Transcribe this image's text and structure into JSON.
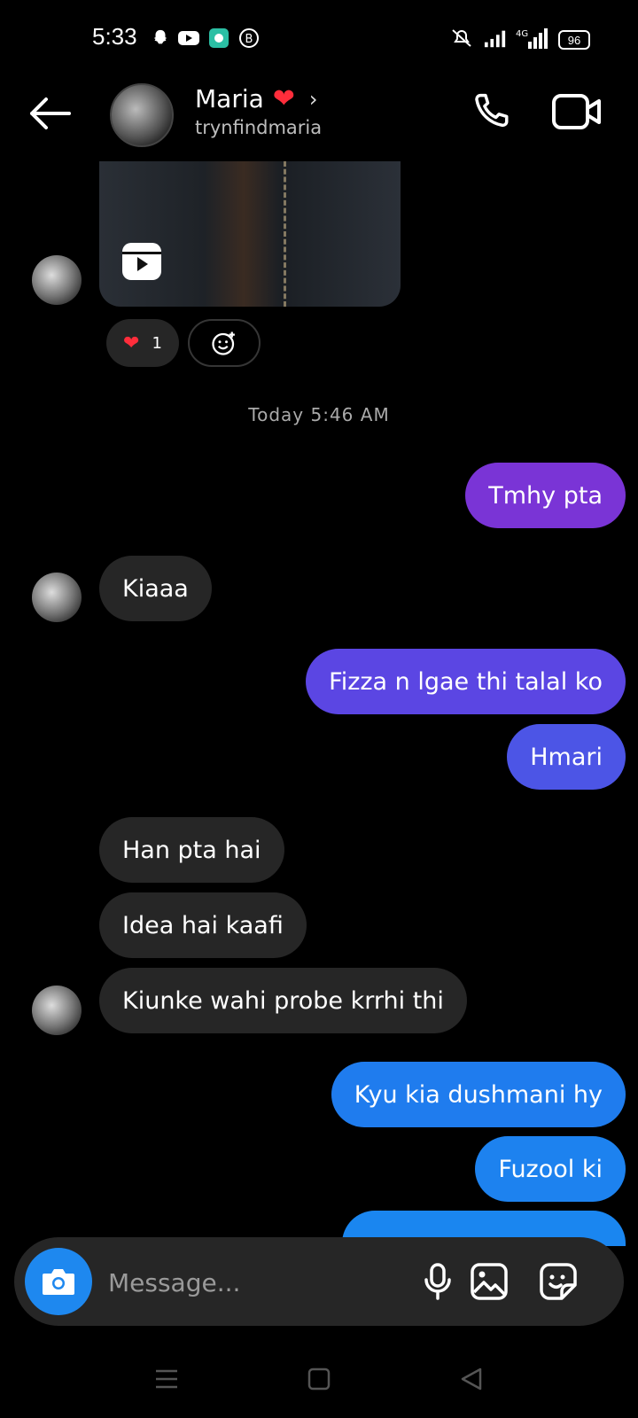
{
  "status_bar": {
    "time": "5:33",
    "battery": "96",
    "network": "4G",
    "icons": [
      "snapchat-icon",
      "youtube-icon",
      "app-icon",
      "b-icon",
      "mute-icon",
      "signal-icon",
      "signal-4g-icon",
      "battery-icon"
    ]
  },
  "header": {
    "name": "Maria",
    "name_emoji": "❤",
    "username": "trynfindmaria",
    "back_icon": "back-arrow-icon",
    "call_icon": "phone-icon",
    "video_icon": "video-call-icon"
  },
  "reactions": {
    "heart_emoji": "❤",
    "heart_count": "1"
  },
  "timestamp": "Today 5:46 AM",
  "messages": [
    {
      "side": "out",
      "text": "Tmhy pta",
      "color": "#7a34d6"
    },
    {
      "side": "in",
      "text": "Kiaaa"
    },
    {
      "side": "out",
      "text": "Fizza n lgae thi talal ko",
      "color": "#5b46e3"
    },
    {
      "side": "out",
      "text": "Hmari",
      "color": "#4c55e6"
    },
    {
      "side": "in",
      "text": "Han pta hai"
    },
    {
      "side": "in",
      "text": "Idea hai kaafi"
    },
    {
      "side": "in",
      "text": "Kiunke wahi probe krrhi thi"
    },
    {
      "side": "out",
      "text": "Kyu kia dushmani hy",
      "color": "#1f7cee"
    },
    {
      "side": "out",
      "text": "Fuzool ki",
      "color": "#1d82ef"
    }
  ],
  "composer": {
    "placeholder": "Message..."
  },
  "colors": {
    "background": "#000000",
    "incoming_bubble": "#262626",
    "camera_button": "#1e88ef"
  }
}
